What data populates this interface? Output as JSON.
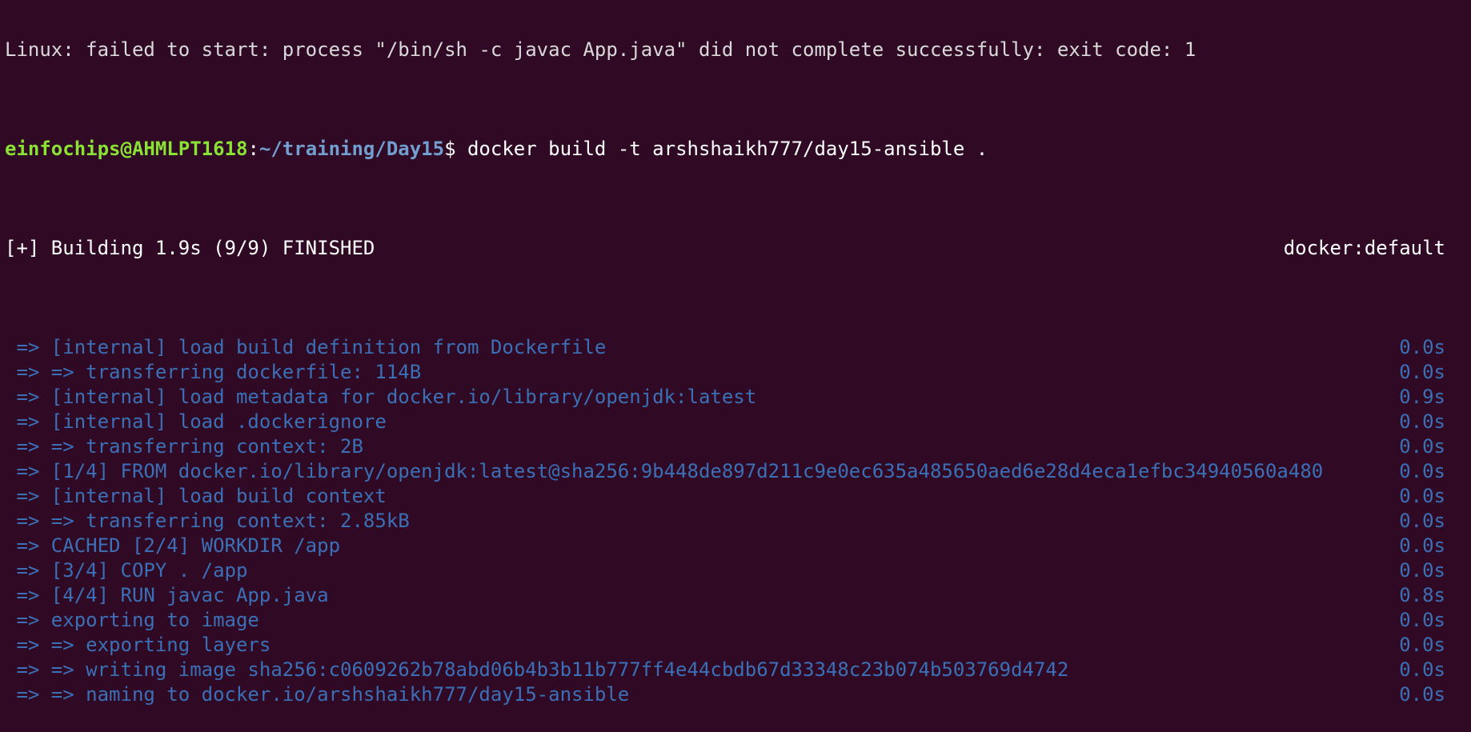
{
  "terminal": {
    "cut_line": "Linux: failed to start: process \"/bin/sh -c javac App.java\" did not complete successfully: exit code: 1",
    "prompt": {
      "user_host": "einfochips@AHMLPT1618",
      "sep": ":",
      "path": "~/training/Day15",
      "dollar": "$ ",
      "command": "docker build -t arshshaikh777/day15-ansible ."
    },
    "header": {
      "left": "[+] Building 1.9s (9/9) FINISHED",
      "right": "docker:default"
    },
    "steps": [
      {
        "text": " => [internal] load build definition from Dockerfile",
        "time": "0.0s"
      },
      {
        "text": " => => transferring dockerfile: 114B",
        "time": "0.0s"
      },
      {
        "text": " => [internal] load metadata for docker.io/library/openjdk:latest",
        "time": "0.9s"
      },
      {
        "text": " => [internal] load .dockerignore",
        "time": "0.0s"
      },
      {
        "text": " => => transferring context: 2B",
        "time": "0.0s"
      },
      {
        "text": " => [1/4] FROM docker.io/library/openjdk:latest@sha256:9b448de897d211c9e0ec635a485650aed6e28d4eca1efbc34940560a480",
        "time": "0.0s"
      },
      {
        "text": " => [internal] load build context",
        "time": "0.0s"
      },
      {
        "text": " => => transferring context: 2.85kB",
        "time": "0.0s"
      },
      {
        "text": " => CACHED [2/4] WORKDIR /app",
        "time": "0.0s"
      },
      {
        "text": " => [3/4] COPY . /app",
        "time": "0.0s"
      },
      {
        "text": " => [4/4] RUN javac App.java",
        "time": "0.8s"
      },
      {
        "text": " => exporting to image",
        "time": "0.0s"
      },
      {
        "text": " => => exporting layers",
        "time": "0.0s"
      },
      {
        "text": " => => writing image sha256:c0609262b78abd06b4b3b11b777ff4e44cbdb67d33348c23b074b503769d4742",
        "time": "0.0s"
      },
      {
        "text": " => => naming to docker.io/arshshaikh777/day15-ansible",
        "time": "0.0s"
      }
    ]
  }
}
